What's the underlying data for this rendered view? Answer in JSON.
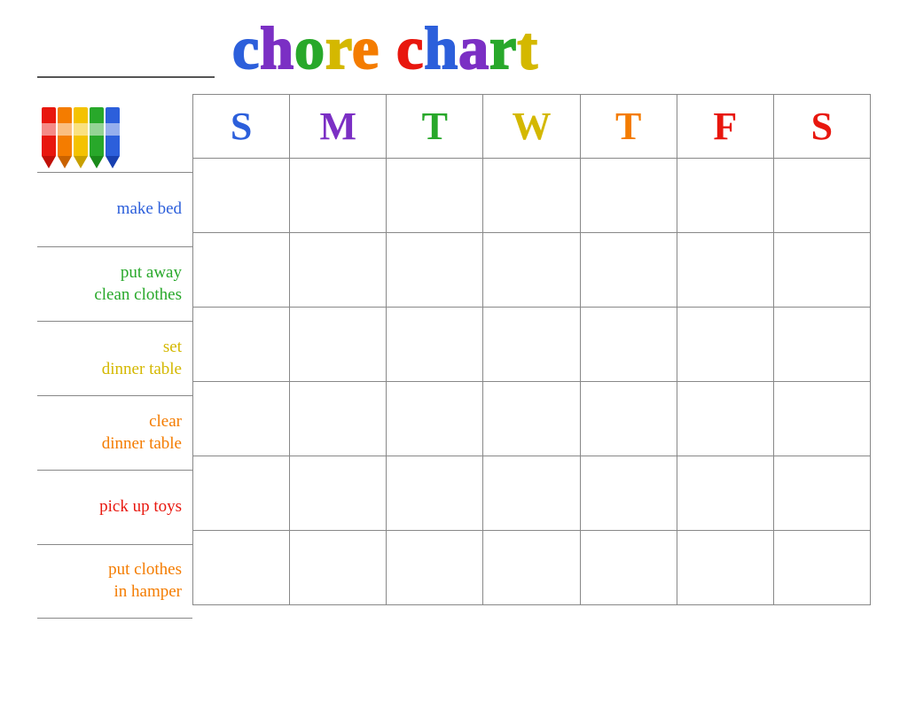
{
  "header": {
    "title": "chore chart",
    "name_line_placeholder": ""
  },
  "title_letters": [
    {
      "char": "c",
      "color": "#2c5fdb"
    },
    {
      "char": "h",
      "color": "#7b2fc4"
    },
    {
      "char": "o",
      "color": "#28a82a"
    },
    {
      "char": "r",
      "color": "#e8c000"
    },
    {
      "char": "e",
      "color": "#f47c00"
    },
    {
      "char": " ",
      "color": "transparent"
    },
    {
      "char": "c",
      "color": "#e8170e"
    },
    {
      "char": "h",
      "color": "#2c5fdb"
    },
    {
      "char": "a",
      "color": "#7b2fc4"
    },
    {
      "char": "r",
      "color": "#28a82a"
    },
    {
      "char": "t",
      "color": "#e8c000"
    }
  ],
  "days": [
    {
      "label": "S",
      "color": "#2c5fdb"
    },
    {
      "label": "M",
      "color": "#7b2fc4"
    },
    {
      "label": "T",
      "color": "#28a82a"
    },
    {
      "label": "W",
      "color": "#e8c000"
    },
    {
      "label": "T",
      "color": "#f47c00"
    },
    {
      "label": "F",
      "color": "#e8170e"
    },
    {
      "label": "S",
      "color": "#e8170e"
    }
  ],
  "chores": [
    {
      "label": "make bed",
      "color": "#2c5fdb",
      "multiline": false
    },
    {
      "label": "put away\nclean clothes",
      "color": "#28a82a",
      "multiline": true
    },
    {
      "label": "set\ndinner table",
      "color": "#d4c000",
      "multiline": true
    },
    {
      "label": "clear\ndinner table",
      "color": "#f47c00",
      "multiline": true
    },
    {
      "label": "pick up toys",
      "color": "#e8170e",
      "multiline": false
    },
    {
      "label": "put clothes\nin hamper",
      "color": "#f47c00",
      "multiline": true
    }
  ],
  "crayons": [
    {
      "body": "#e8170e",
      "tip": "#c01008"
    },
    {
      "body": "#f47c00",
      "tip": "#c86000"
    },
    {
      "body": "#f4c200",
      "tip": "#c8a000"
    },
    {
      "body": "#28a82a",
      "tip": "#1a8a1a"
    },
    {
      "body": "#2c5fdb",
      "tip": "#1840b0"
    }
  ]
}
